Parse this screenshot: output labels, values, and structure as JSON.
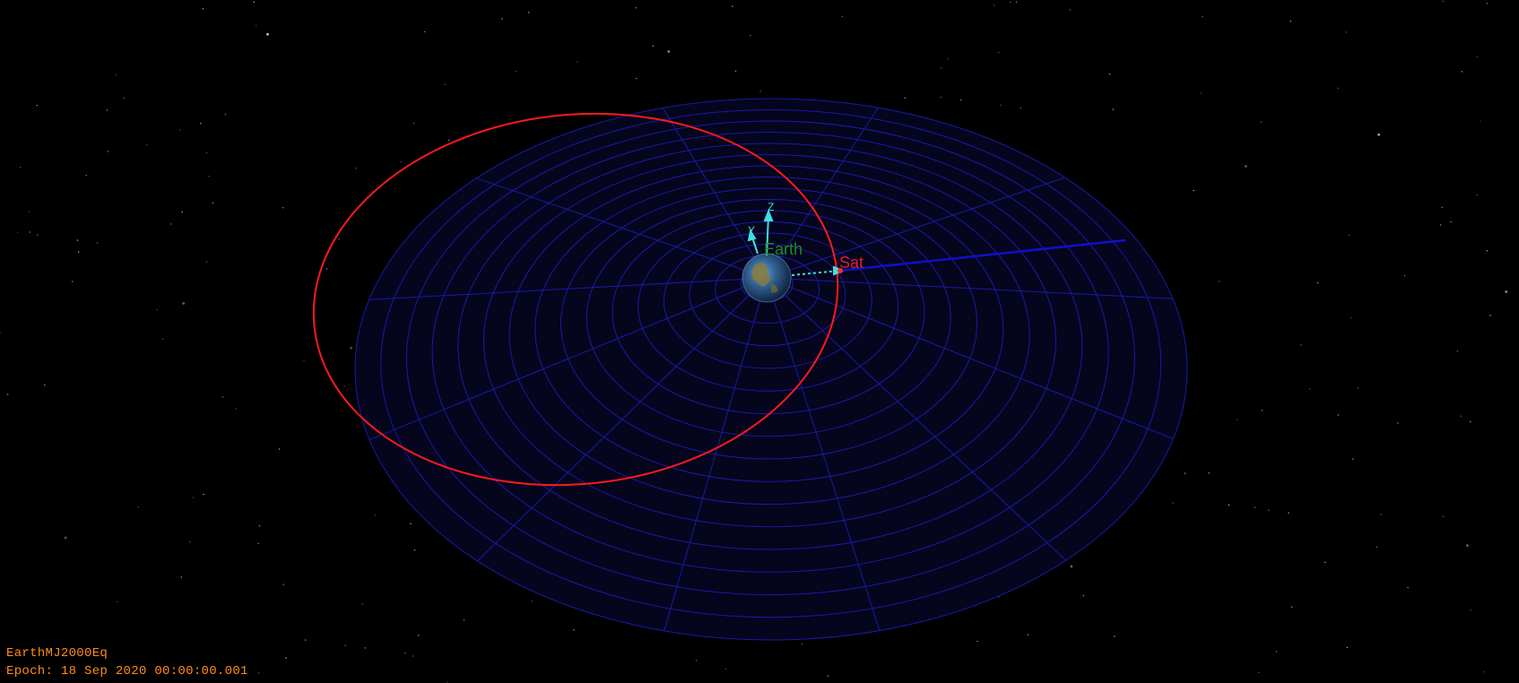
{
  "hud": {
    "coordinate_system": "EarthMJ2000Eq",
    "epoch": "Epoch: 18 Sep 2020 00:00:00.001"
  },
  "labels": {
    "earth": "Earth",
    "sat": "Sat",
    "axis_z": "Z",
    "axis_y": "Y"
  },
  "colors": {
    "background": "#000000",
    "grid": "#1a1aa8",
    "grid_fill": "#05051e",
    "orbit": "#ff1a1a",
    "sat_label": "#e0202a",
    "earth_label": "#1f8a1f",
    "axes": "#3fe0e0",
    "hud_text": "#ff8c1a"
  }
}
